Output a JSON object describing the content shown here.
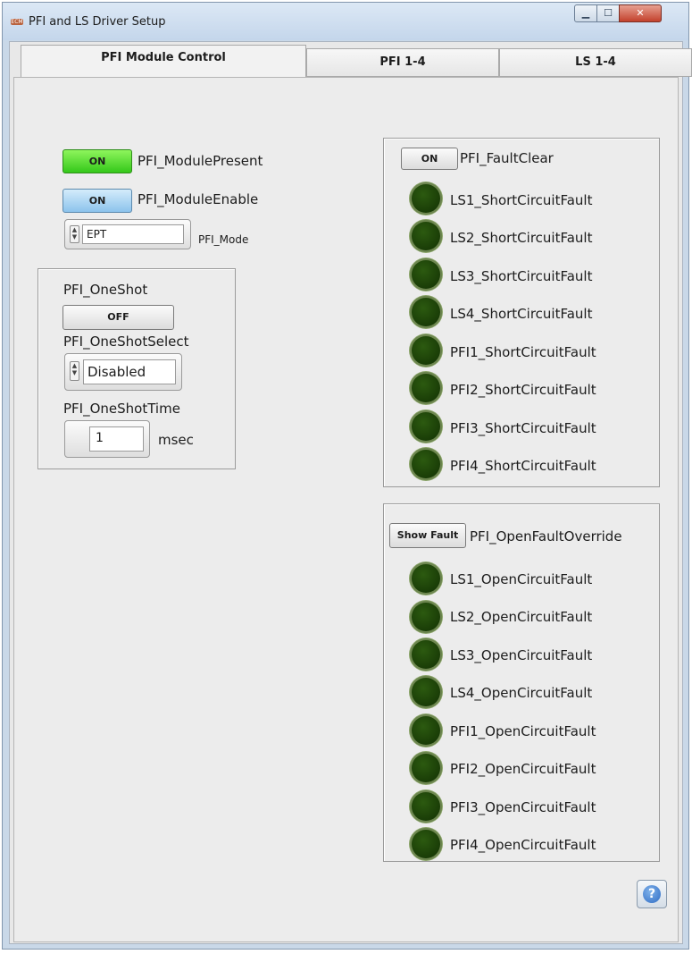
{
  "window": {
    "title": "PFI and LS Driver Setup",
    "app_icon_text": "ECM",
    "min_glyph": "▁",
    "max_glyph": "☐",
    "close_glyph": "✕"
  },
  "tabs": [
    {
      "label": "PFI Module Control",
      "active": true
    },
    {
      "label": "PFI 1-4",
      "active": false
    },
    {
      "label": "LS 1-4",
      "active": false
    }
  ],
  "module": {
    "present": {
      "button": "ON",
      "label": "PFI_ModulePresent",
      "color": "#3cd41f"
    },
    "enable": {
      "button": "ON",
      "label": "PFI_ModuleEnable",
      "color": "#8cc3ec"
    },
    "mode": {
      "value": "EPT",
      "label": "PFI_Mode"
    }
  },
  "oneshot": {
    "label": "PFI_OneShot",
    "button": "OFF",
    "select_label": "PFI_OneShotSelect",
    "select_value": "Disabled",
    "time_label": "PFI_OneShotTime",
    "time_value": "1",
    "time_unit": "msec"
  },
  "short_panel": {
    "clear_button": "ON",
    "clear_label": "PFI_FaultClear",
    "led_color": "#1f4a08",
    "faults": [
      "LS1_ShortCircuitFault",
      "LS2_ShortCircuitFault",
      "LS3_ShortCircuitFault",
      "LS4_ShortCircuitFault",
      "PFI1_ShortCircuitFault",
      "PFI2_ShortCircuitFault",
      "PFI3_ShortCircuitFault",
      "PFI4_ShortCircuitFault"
    ]
  },
  "open_panel": {
    "override_button": "Show Fault",
    "override_label": "PFI_OpenFaultOverride",
    "faults": [
      "LS1_OpenCircuitFault",
      "LS2_OpenCircuitFault",
      "LS3_OpenCircuitFault",
      "LS4_OpenCircuitFault",
      "PFI1_OpenCircuitFault",
      "PFI2_OpenCircuitFault",
      "PFI3_OpenCircuitFault",
      "PFI4_OpenCircuitFault"
    ]
  },
  "help": {
    "glyph": "?"
  }
}
